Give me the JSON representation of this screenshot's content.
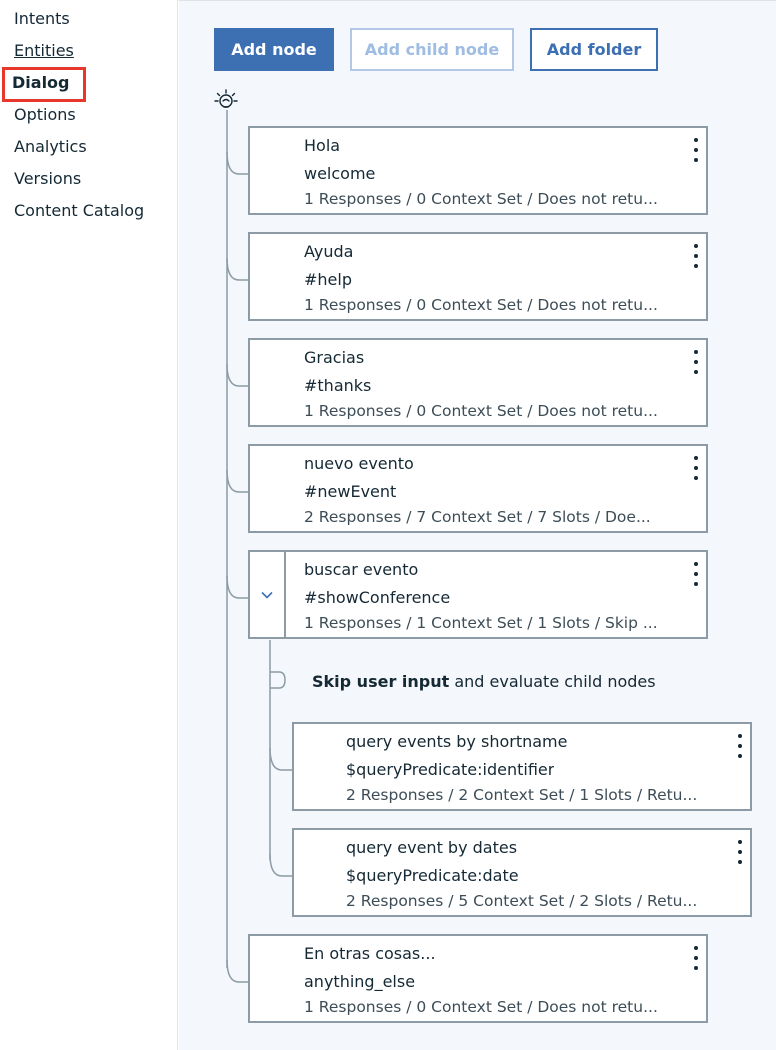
{
  "sidebar": {
    "items": [
      {
        "label": "Intents"
      },
      {
        "label": "Entities"
      },
      {
        "label": "Dialog"
      },
      {
        "label": "Options"
      },
      {
        "label": "Analytics"
      },
      {
        "label": "Versions"
      },
      {
        "label": "Content Catalog"
      }
    ]
  },
  "toolbar": {
    "add_node": "Add node",
    "add_child_node": "Add child node",
    "add_folder": "Add folder"
  },
  "nodes": [
    {
      "title": "Hola",
      "condition": "welcome",
      "summary": "1 Responses / 0 Context Set / Does not retu..."
    },
    {
      "title": "Ayuda",
      "condition": "#help",
      "summary": "1 Responses / 0 Context Set / Does not retu..."
    },
    {
      "title": "Gracias",
      "condition": "#thanks",
      "summary": "1 Responses / 0 Context Set / Does not retu..."
    },
    {
      "title": "nuevo evento",
      "condition": "#newEvent",
      "summary": "2 Responses / 7 Context Set / 7 Slots / Doe..."
    },
    {
      "title": "buscar evento",
      "condition": "#showConference",
      "summary": "1 Responses / 1 Context Set / 1 Slots / Skip ..."
    },
    {
      "title": "En otras cosas...",
      "condition": "anything_else",
      "summary": "1 Responses / 0 Context Set / Does not retu..."
    }
  ],
  "skip_user_input": {
    "bold": "Skip user input",
    "rest": " and evaluate child nodes"
  },
  "child_nodes": [
    {
      "title": "query events by shortname",
      "condition": "$queryPredicate:identifier",
      "summary": "2 Responses / 2 Context Set / 1 Slots / Retu..."
    },
    {
      "title": "query event by dates",
      "condition": "$queryPredicate:date",
      "summary": "2 Responses / 5 Context Set / 2 Slots / Retu..."
    }
  ],
  "icons": {
    "root": "lightbulb-icon",
    "expander": "chevron-down-icon",
    "node_menu": "overflow-menu-icon"
  },
  "colors": {
    "primary": "#3d70b2",
    "highlight": "#e8372c",
    "node_border": "#8c9ba5",
    "background": "#f4f7fb"
  }
}
